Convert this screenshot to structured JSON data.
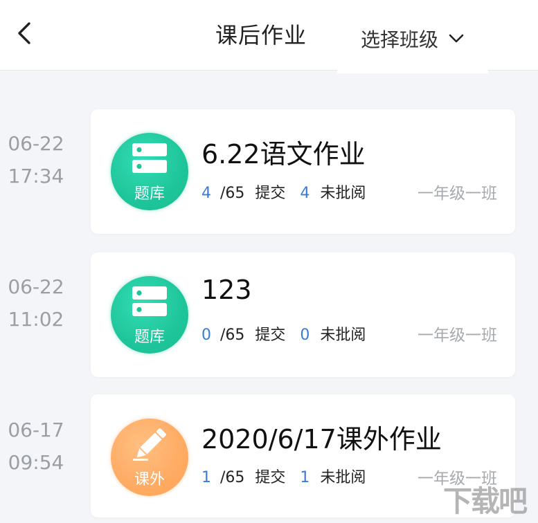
{
  "header": {
    "title": "课后作业",
    "class_select_label": "选择班级"
  },
  "assignments": [
    {
      "date": "06-22",
      "time": "17:34",
      "badge_label": "题库",
      "badge_type": "question-bank",
      "title": "6.22语文作业",
      "submitted": "4",
      "total": "/65",
      "submitted_label": "提交",
      "unreviewed": "4",
      "unreviewed_label": "未批阅",
      "class_name": "一年级一班"
    },
    {
      "date": "06-22",
      "time": "11:02",
      "badge_label": "题库",
      "badge_type": "question-bank",
      "title": "123",
      "submitted": "0",
      "total": "/65",
      "submitted_label": "提交",
      "unreviewed": "0",
      "unreviewed_label": "未批阅",
      "class_name": "一年级一班"
    },
    {
      "date": "06-17",
      "time": "09:54",
      "badge_label": "课外",
      "badge_type": "extracurricular",
      "title": "2020/6/17课外作业",
      "submitted": "1",
      "total": "/65",
      "submitted_label": "提交",
      "unreviewed": "1",
      "unreviewed_label": "未批阅",
      "class_name": "一年级一班"
    }
  ],
  "watermark": "下载吧",
  "colors": {
    "accent_number": "#3a7bd5",
    "badge_green": "#1fc59a",
    "badge_orange": "#ffab63"
  }
}
